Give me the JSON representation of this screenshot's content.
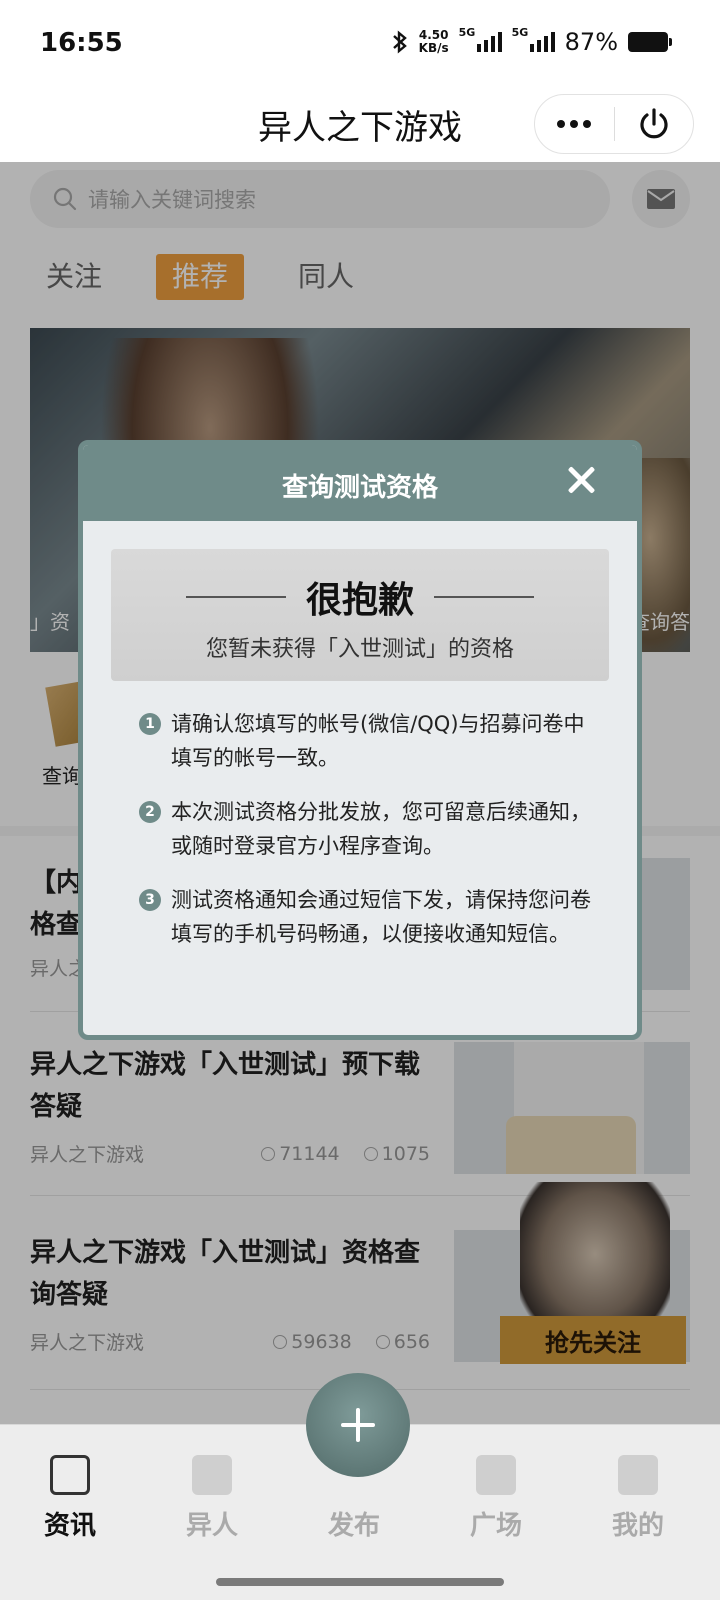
{
  "status_bar": {
    "time": "16:55",
    "net_speed_value": "4.50",
    "net_speed_unit": "KB/s",
    "sim1": "5G",
    "sim2": "5G",
    "battery": "87%"
  },
  "navbar": {
    "title": "异人之下游戏"
  },
  "search": {
    "placeholder": "请输入关键词搜索"
  },
  "tabs": [
    {
      "label": "关注",
      "active": false
    },
    {
      "label": "推荐",
      "active": true
    },
    {
      "label": "同人",
      "active": false
    }
  ],
  "banner": {
    "caption_left": "」资",
    "caption_right": "查询答"
  },
  "quick_entry": {
    "label": "查询"
  },
  "articles": [
    {
      "title": "【内",
      "title_line2": "格查",
      "author": "异人之"
    },
    {
      "title": "异人之下游戏「入世测试」预下载答疑",
      "author": "异人之下游戏",
      "views": "71144",
      "comments": "1075"
    },
    {
      "title": "异人之下游戏「入世测试」资格查询答疑",
      "author": "异人之下游戏",
      "views": "59638",
      "comments": "656"
    }
  ],
  "promo": {
    "label": "抢先关注"
  },
  "modal": {
    "title": "查询测试资格",
    "sorry_title": "很抱歉",
    "sorry_subtitle": "您暂未获得「入世测试」的资格",
    "notes": [
      {
        "num": "1",
        "text": "请确认您填写的帐号(微信/QQ)与招募问卷中填写的帐号一致。"
      },
      {
        "num": "2",
        "text": "本次测试资格分批发放，您可留意后续通知，或随时登录官方小程序查询。"
      },
      {
        "num": "3",
        "text": "测试资格通知会通过短信下发，请保持您问卷填写的手机号码畅通，以便接收通知短信。"
      }
    ]
  },
  "tabbar": {
    "items": [
      {
        "label": "资讯",
        "icon": "news-icon",
        "active": true
      },
      {
        "label": "异人",
        "icon": "scroll-icon",
        "active": false
      },
      {
        "label": "发布",
        "icon": "plus-icon",
        "active": false
      },
      {
        "label": "广场",
        "icon": "chat-icon",
        "active": false
      },
      {
        "label": "我的",
        "icon": "user-icon",
        "active": false
      }
    ]
  },
  "colors": {
    "accent_orange": "#f0a040",
    "modal_teal": "#6f8b89",
    "promo_gold": "#d09a3c"
  }
}
